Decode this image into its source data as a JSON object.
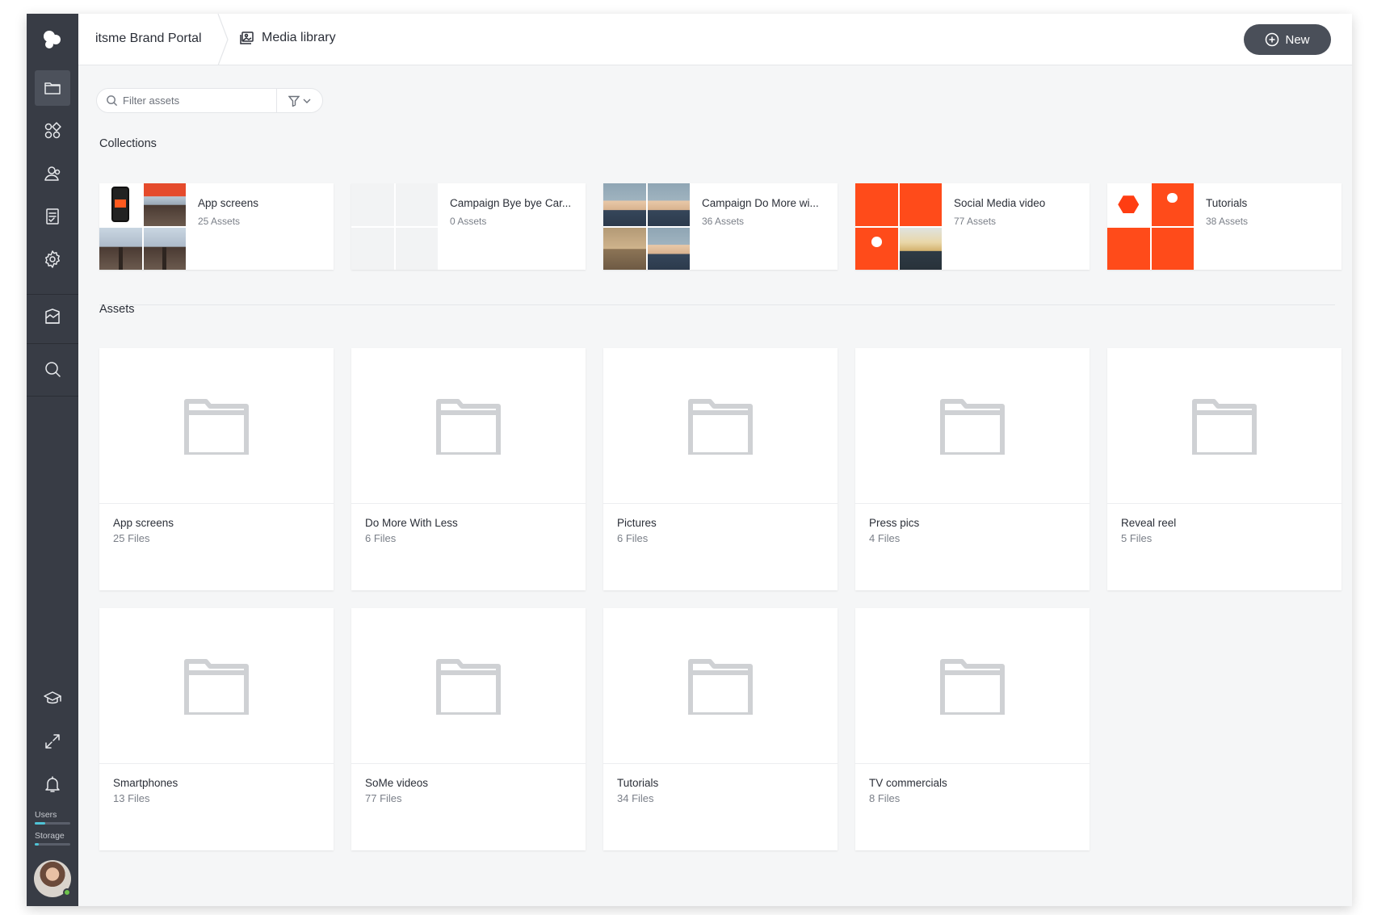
{
  "header": {
    "portal_name": "itsme Brand Portal",
    "section_name": "Media library",
    "new_button": "New"
  },
  "filter": {
    "placeholder": "Filter assets"
  },
  "sidebar": {
    "items": [
      {
        "icon": "folder-icon",
        "active": true
      },
      {
        "icon": "apps-icon",
        "active": false
      },
      {
        "icon": "users-icon",
        "active": false
      },
      {
        "icon": "checklist-icon",
        "active": false
      },
      {
        "icon": "gear-icon",
        "active": false
      },
      {
        "icon": "brand-guide-icon",
        "active": false
      },
      {
        "icon": "search-icon",
        "active": false
      },
      {
        "icon": "graduation-cap-icon",
        "active": false
      },
      {
        "icon": "expand-icon",
        "active": false
      },
      {
        "icon": "bell-icon",
        "active": false
      }
    ],
    "users_label": "Users",
    "storage_label": "Storage",
    "users_usage": 0.3,
    "storage_usage": 0.12
  },
  "collections": {
    "title": "Collections",
    "items": [
      {
        "name": "App screens",
        "count": "25 Assets"
      },
      {
        "name": "Campaign Bye bye Car...",
        "count": "0 Assets"
      },
      {
        "name": "Campaign Do More wi...",
        "count": "36 Assets"
      },
      {
        "name": "Social Media video",
        "count": "77 Assets"
      },
      {
        "name": "Tutorials",
        "count": "38 Assets"
      }
    ]
  },
  "assets": {
    "title": "Assets",
    "folders": [
      {
        "name": "App screens",
        "count": "25 Files"
      },
      {
        "name": "Do More With Less",
        "count": "6 Files"
      },
      {
        "name": "Pictures",
        "count": "6 Files"
      },
      {
        "name": "Press pics",
        "count": "4 Files"
      },
      {
        "name": "Reveal reel",
        "count": "5 Files"
      },
      {
        "name": "Smartphones",
        "count": "13 Files"
      },
      {
        "name": "SoMe videos",
        "count": "77 Files"
      },
      {
        "name": "Tutorials",
        "count": "34 Files"
      },
      {
        "name": "TV commercials",
        "count": "8 Files"
      }
    ]
  },
  "colors": {
    "sidebar": "#383c45",
    "accent_orange": "#ff4b1a",
    "button": "#4a4f59",
    "storage_bar": "#4fc3d6"
  }
}
